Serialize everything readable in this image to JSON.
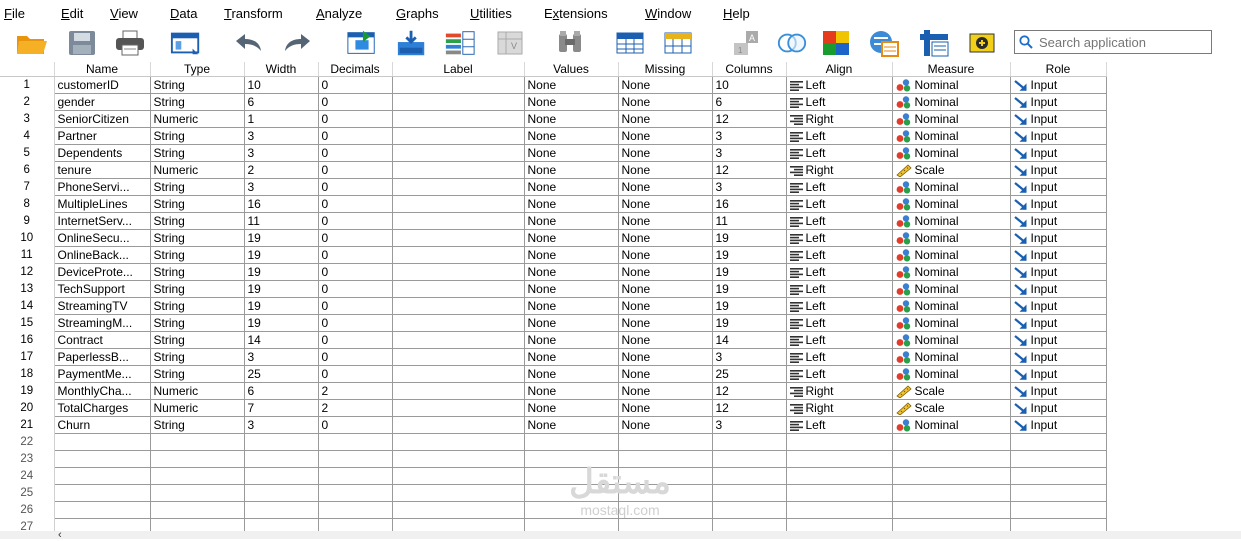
{
  "menu": [
    {
      "label": "File",
      "u": "F"
    },
    {
      "label": "Edit",
      "u": "E"
    },
    {
      "label": "View",
      "u": "V"
    },
    {
      "label": "Data",
      "u": "D"
    },
    {
      "label": "Transform",
      "u": "T"
    },
    {
      "label": "Analyze",
      "u": "A"
    },
    {
      "label": "Graphs",
      "u": "G"
    },
    {
      "label": "Utilities",
      "u": "U"
    },
    {
      "label": "Extensions",
      "u": "x"
    },
    {
      "label": "Window",
      "u": "W"
    },
    {
      "label": "Help",
      "u": "H"
    }
  ],
  "search": {
    "placeholder": "Search application"
  },
  "columns": [
    "Name",
    "Type",
    "Width",
    "Decimals",
    "Label",
    "Values",
    "Missing",
    "Columns",
    "Align",
    "Measure",
    "Role"
  ],
  "rows": [
    {
      "n": "1",
      "name": "customerID",
      "type": "String",
      "width": "10",
      "dec": "0",
      "label": "",
      "values": "None",
      "missing": "None",
      "columns": "10",
      "align": "Left",
      "measure": "Nominal",
      "role": "Input"
    },
    {
      "n": "2",
      "name": "gender",
      "type": "String",
      "width": "6",
      "dec": "0",
      "label": "",
      "values": "None",
      "missing": "None",
      "columns": "6",
      "align": "Left",
      "measure": "Nominal",
      "role": "Input"
    },
    {
      "n": "3",
      "name": "SeniorCitizen",
      "type": "Numeric",
      "width": "1",
      "dec": "0",
      "label": "",
      "values": "None",
      "missing": "None",
      "columns": "12",
      "align": "Right",
      "measure": "Nominal",
      "role": "Input"
    },
    {
      "n": "4",
      "name": "Partner",
      "type": "String",
      "width": "3",
      "dec": "0",
      "label": "",
      "values": "None",
      "missing": "None",
      "columns": "3",
      "align": "Left",
      "measure": "Nominal",
      "role": "Input"
    },
    {
      "n": "5",
      "name": "Dependents",
      "type": "String",
      "width": "3",
      "dec": "0",
      "label": "",
      "values": "None",
      "missing": "None",
      "columns": "3",
      "align": "Left",
      "measure": "Nominal",
      "role": "Input"
    },
    {
      "n": "6",
      "name": "tenure",
      "type": "Numeric",
      "width": "2",
      "dec": "0",
      "label": "",
      "values": "None",
      "missing": "None",
      "columns": "12",
      "align": "Right",
      "measure": "Scale",
      "role": "Input"
    },
    {
      "n": "7",
      "name": "PhoneServi...",
      "type": "String",
      "width": "3",
      "dec": "0",
      "label": "",
      "values": "None",
      "missing": "None",
      "columns": "3",
      "align": "Left",
      "measure": "Nominal",
      "role": "Input"
    },
    {
      "n": "8",
      "name": "MultipleLines",
      "type": "String",
      "width": "16",
      "dec": "0",
      "label": "",
      "values": "None",
      "missing": "None",
      "columns": "16",
      "align": "Left",
      "measure": "Nominal",
      "role": "Input"
    },
    {
      "n": "9",
      "name": "InternetServ...",
      "type": "String",
      "width": "11",
      "dec": "0",
      "label": "",
      "values": "None",
      "missing": "None",
      "columns": "11",
      "align": "Left",
      "measure": "Nominal",
      "role": "Input"
    },
    {
      "n": "10",
      "name": "OnlineSecu...",
      "type": "String",
      "width": "19",
      "dec": "0",
      "label": "",
      "values": "None",
      "missing": "None",
      "columns": "19",
      "align": "Left",
      "measure": "Nominal",
      "role": "Input"
    },
    {
      "n": "11",
      "name": "OnlineBack...",
      "type": "String",
      "width": "19",
      "dec": "0",
      "label": "",
      "values": "None",
      "missing": "None",
      "columns": "19",
      "align": "Left",
      "measure": "Nominal",
      "role": "Input"
    },
    {
      "n": "12",
      "name": "DeviceProte...",
      "type": "String",
      "width": "19",
      "dec": "0",
      "label": "",
      "values": "None",
      "missing": "None",
      "columns": "19",
      "align": "Left",
      "measure": "Nominal",
      "role": "Input"
    },
    {
      "n": "13",
      "name": "TechSupport",
      "type": "String",
      "width": "19",
      "dec": "0",
      "label": "",
      "values": "None",
      "missing": "None",
      "columns": "19",
      "align": "Left",
      "measure": "Nominal",
      "role": "Input"
    },
    {
      "n": "14",
      "name": "StreamingTV",
      "type": "String",
      "width": "19",
      "dec": "0",
      "label": "",
      "values": "None",
      "missing": "None",
      "columns": "19",
      "align": "Left",
      "measure": "Nominal",
      "role": "Input"
    },
    {
      "n": "15",
      "name": "StreamingM...",
      "type": "String",
      "width": "19",
      "dec": "0",
      "label": "",
      "values": "None",
      "missing": "None",
      "columns": "19",
      "align": "Left",
      "measure": "Nominal",
      "role": "Input"
    },
    {
      "n": "16",
      "name": "Contract",
      "type": "String",
      "width": "14",
      "dec": "0",
      "label": "",
      "values": "None",
      "missing": "None",
      "columns": "14",
      "align": "Left",
      "measure": "Nominal",
      "role": "Input"
    },
    {
      "n": "17",
      "name": "PaperlessB...",
      "type": "String",
      "width": "3",
      "dec": "0",
      "label": "",
      "values": "None",
      "missing": "None",
      "columns": "3",
      "align": "Left",
      "measure": "Nominal",
      "role": "Input"
    },
    {
      "n": "18",
      "name": "PaymentMe...",
      "type": "String",
      "width": "25",
      "dec": "0",
      "label": "",
      "values": "None",
      "missing": "None",
      "columns": "25",
      "align": "Left",
      "measure": "Nominal",
      "role": "Input"
    },
    {
      "n": "19",
      "name": "MonthlyCha...",
      "type": "Numeric",
      "width": "6",
      "dec": "2",
      "label": "",
      "values": "None",
      "missing": "None",
      "columns": "12",
      "align": "Right",
      "measure": "Scale",
      "role": "Input"
    },
    {
      "n": "20",
      "name": "TotalCharges",
      "type": "Numeric",
      "width": "7",
      "dec": "2",
      "label": "",
      "values": "None",
      "missing": "None",
      "columns": "12",
      "align": "Right",
      "measure": "Scale",
      "role": "Input"
    },
    {
      "n": "21",
      "name": "Churn",
      "type": "String",
      "width": "3",
      "dec": "0",
      "label": "",
      "values": "None",
      "missing": "None",
      "columns": "3",
      "align": "Left",
      "measure": "Nominal",
      "role": "Input"
    }
  ],
  "empty_rows": [
    "22",
    "23",
    "24",
    "25",
    "26",
    "27"
  ],
  "watermark": {
    "arabic": "مستقل",
    "latin": "mostaql.com"
  },
  "colors": {
    "accent": "#1c6fc9",
    "folder": "#f2a413"
  }
}
